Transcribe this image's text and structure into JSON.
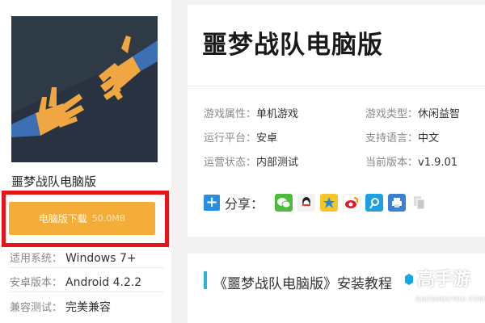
{
  "app": {
    "name": "噩梦战队电脑版",
    "download_label": "电脑版下载",
    "download_size": "50.0MB"
  },
  "specs": [
    {
      "label": "适用系统：",
      "value": "Windows 7+"
    },
    {
      "label": "安卓版本：",
      "value": "Android 4.2.2"
    },
    {
      "label": "兼容测试：",
      "value": "完美兼容"
    }
  ],
  "detail": {
    "title": "噩梦战队电脑版",
    "attributes": [
      {
        "label": "游戏属性：",
        "value": "单机游戏"
      },
      {
        "label": "游戏类型：",
        "value": "休闲益智"
      },
      {
        "label": "运行平台：",
        "value": "安卓"
      },
      {
        "label": "支持语言：",
        "value": "中文"
      },
      {
        "label": "运营状态：",
        "value": "内部测试"
      },
      {
        "label": "当前版本：",
        "value": "v1.9.01"
      }
    ],
    "share_label": "分享：",
    "share_icons": [
      "wechat-icon",
      "qq-icon",
      "qzone-icon",
      "weibo-icon",
      "tencent-weibo-icon",
      "print-icon",
      "copy-icon"
    ]
  },
  "tutorial": {
    "title": "《噩梦战队电脑版》安装教程"
  },
  "watermark": {
    "main": "高手游",
    "sub": "GAOSHOUYOU.COM"
  },
  "colors": {
    "download_button": "#f5ad3a",
    "highlight_border": "#e5141b",
    "accent": "#2ab5d8"
  }
}
